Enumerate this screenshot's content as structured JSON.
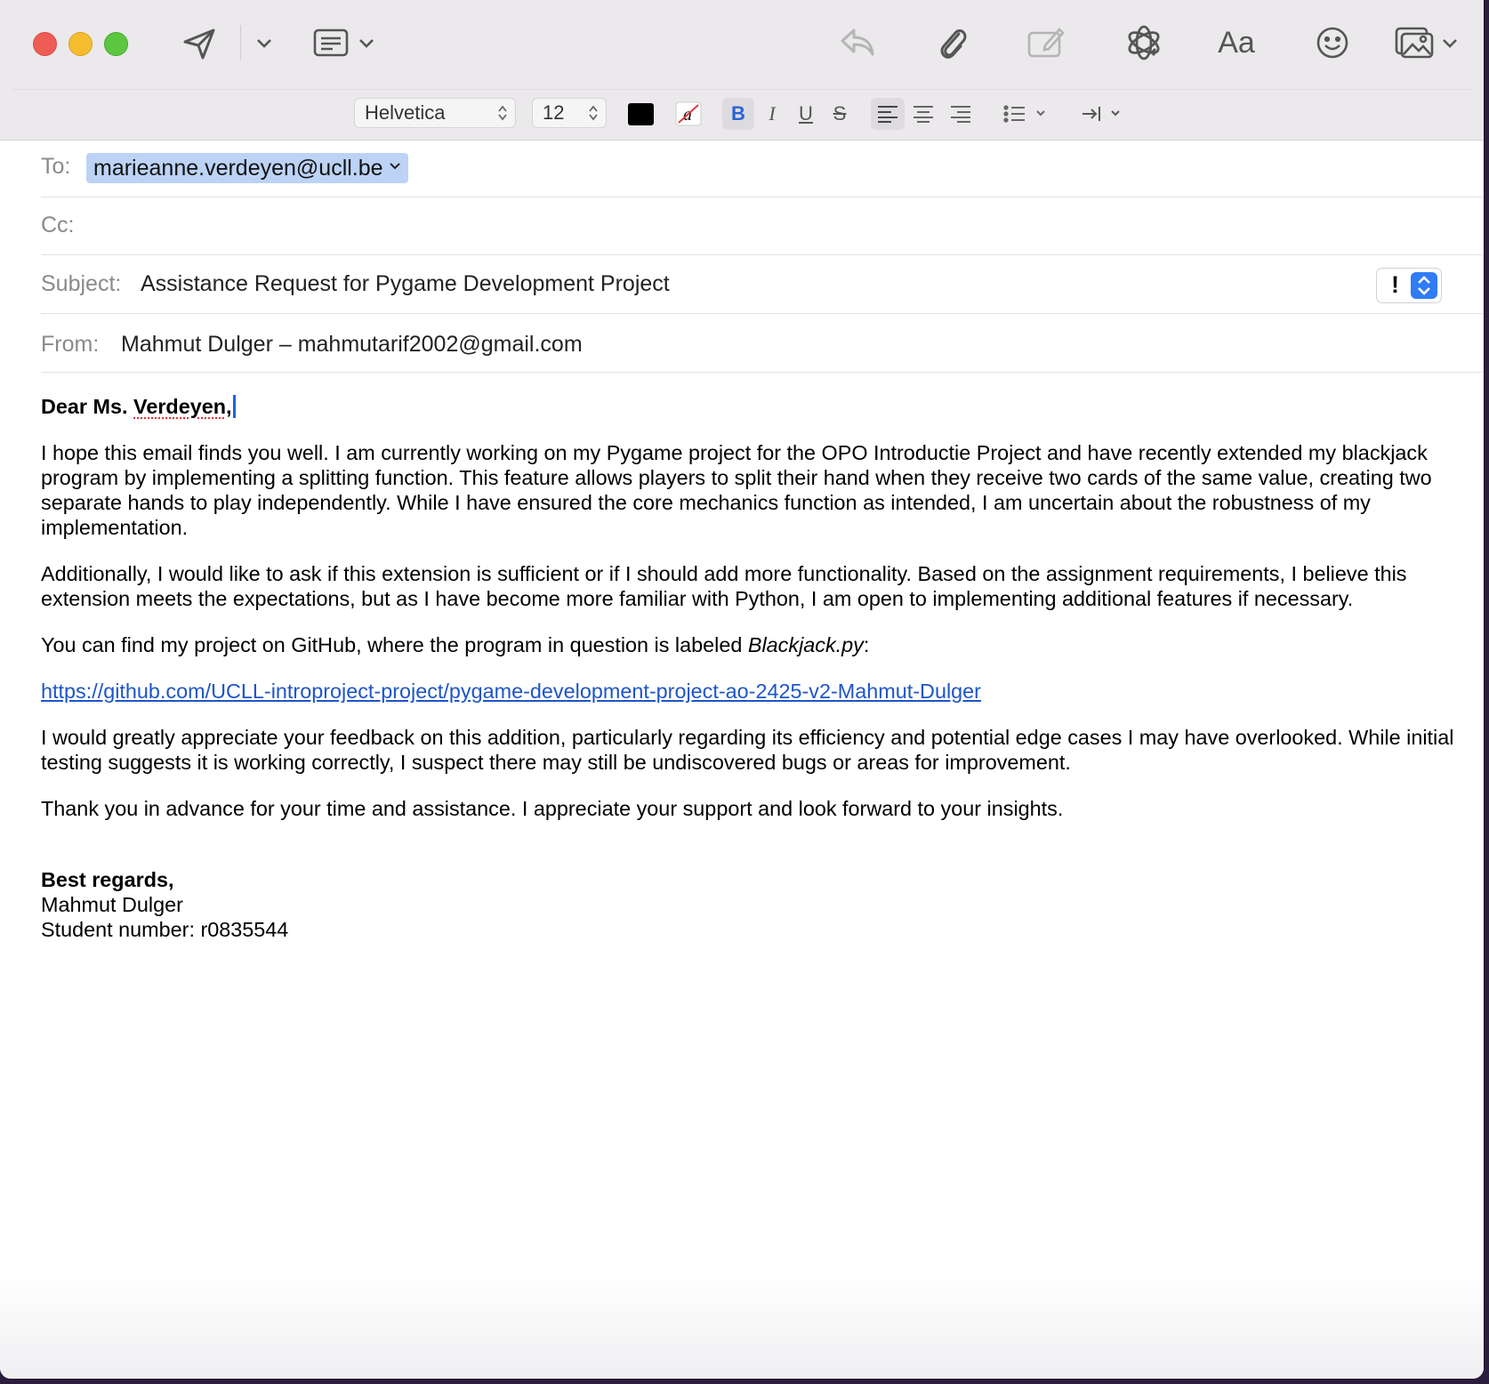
{
  "toolbar": {
    "icons": [
      "send-icon",
      "chevron-down-icon",
      "header-fields-icon",
      "reply-icon",
      "attachment-icon",
      "markup-icon",
      "ai-rewrite-icon",
      "format-icon",
      "emoji-icon",
      "photo-browser-icon"
    ],
    "format_label": "Aa"
  },
  "format_bar": {
    "font": "Helvetica",
    "size": "12",
    "text_color": "#000000",
    "bold": "B",
    "italic": "I",
    "underline": "U",
    "strike": "S"
  },
  "headers": {
    "to_label": "To:",
    "to_value": "marieanne.verdeyen@ucll.be",
    "cc_label": "Cc:",
    "subject_label": "Subject:",
    "subject_value": "Assistance Request for Pygame Development Project",
    "priority": "!",
    "from_label": "From:",
    "from_value": "Mahmut Dulger – mahmutarif2002@gmail.com"
  },
  "body": {
    "greeting_prefix": "Dear Ms. ",
    "greeting_name": "Verdeyen",
    "greeting_suffix": ",",
    "p1": "I hope this email finds you well. I am currently working on my Pygame project for the OPO Introductie Project and have recently extended my blackjack program by implementing a splitting function. This feature allows players to split their hand when they receive two cards of the same value, creating two separate hands to play independently. While I have ensured the core mechanics function as intended, I am uncertain about the robustness of my implementation.",
    "p2": "Additionally, I would like to ask if this extension is sufficient or if I should add more functionality. Based on the assignment requirements, I believe this extension meets the expectations, but as I have become more familiar with Python, I am open to implementing additional features if necessary.",
    "p3_prefix": "You can find my project on GitHub, where the program in question is labeled ",
    "p3_file": "Blackjack.py",
    "p3_suffix": ":",
    "link": "https://github.com/UCLL-introproject-project/pygame-development-project-ao-2425-v2-Mahmut-Dulger",
    "p4": "I would greatly appreciate your feedback on this addition, particularly regarding its efficiency and potential edge cases I may have overlooked. While initial testing suggests it is working correctly, I suspect there may still be undiscovered bugs or areas for improvement.",
    "p5": "Thank you in advance for your time and assistance. I appreciate your support and look forward to your insights.",
    "closing": "Best regards,",
    "name": "Mahmut Dulger",
    "student_number": "Student number: r0835544"
  },
  "colors": {
    "titlebar": "#ebe9eb",
    "token": "#bcd3f5",
    "link": "#1e55c8",
    "accent": "#2f7cf6"
  }
}
